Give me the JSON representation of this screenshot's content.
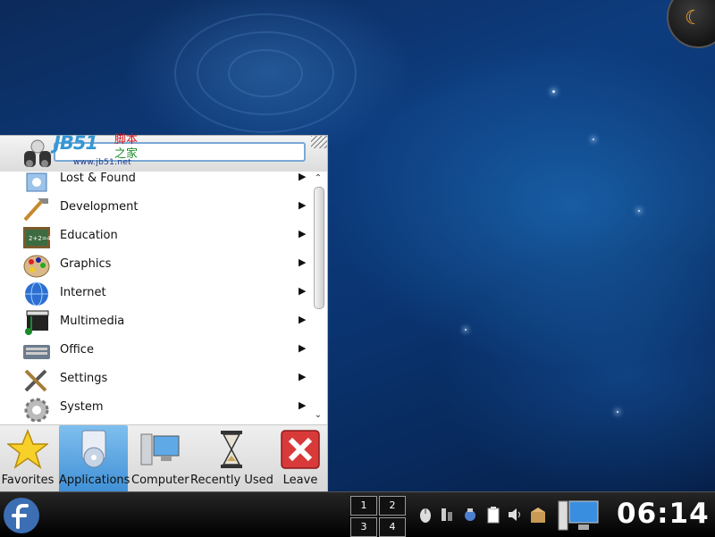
{
  "desktop": {
    "watermark": {
      "logo": "JB51",
      "cn1": "脚本",
      "cn2": "之家",
      "url": "www.jb51.net"
    }
  },
  "kickoff": {
    "search": {
      "value": "",
      "placeholder": ""
    },
    "applications": [
      {
        "label": "Lost & Found",
        "icon": "lost-found-icon"
      },
      {
        "label": "Development",
        "icon": "development-icon"
      },
      {
        "label": "Education",
        "icon": "education-icon"
      },
      {
        "label": "Graphics",
        "icon": "graphics-icon"
      },
      {
        "label": "Internet",
        "icon": "internet-icon"
      },
      {
        "label": "Multimedia",
        "icon": "multimedia-icon"
      },
      {
        "label": "Office",
        "icon": "office-icon"
      },
      {
        "label": "Settings",
        "icon": "settings-icon"
      },
      {
        "label": "System",
        "icon": "system-icon"
      }
    ],
    "submenu_arrow": "▶",
    "scroll_up": "⌃",
    "scroll_down": "⌄",
    "tabs": [
      {
        "label": "Favorites",
        "icon": "star-icon"
      },
      {
        "label": "Applications",
        "icon": "applications-icon",
        "active": true
      },
      {
        "label": "Computer",
        "icon": "computer-icon"
      },
      {
        "label": "Recently Used",
        "icon": "hourglass-icon"
      },
      {
        "label": "Leave",
        "icon": "leave-icon"
      }
    ]
  },
  "panel": {
    "pager": [
      "1",
      "2",
      "3",
      "4"
    ],
    "clock": "06:14",
    "tray": [
      "mouse-icon",
      "network-icon",
      "bluetooth-icon",
      "clipboard-icon",
      "volume-icon",
      "package-updater-icon"
    ]
  },
  "colors": {
    "accent": "#3f8fd6",
    "panel": "#000000",
    "desktop": "#0d3c7e"
  }
}
